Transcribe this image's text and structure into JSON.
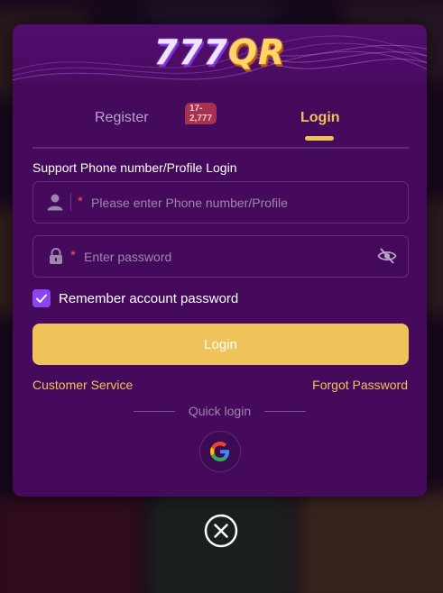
{
  "logo": {
    "numbers": "777",
    "letters": "QR"
  },
  "tabs": {
    "register_label": "Register",
    "register_badge": "17-2,777",
    "login_label": "Login"
  },
  "form": {
    "section_label": "Support Phone number/Profile Login",
    "phone_placeholder": "Please enter Phone number/Profile",
    "password_placeholder": "Enter password",
    "required_mark": "*",
    "remember_label": "Remember account password",
    "remember_checked": true,
    "login_button": "Login"
  },
  "links": {
    "customer_service": "Customer Service",
    "forgot_password": "Forgot Password"
  },
  "quick_login": {
    "label": "Quick login",
    "provider_icon": "google-icon"
  },
  "icons": {
    "user": "user-icon",
    "lock": "lock-icon",
    "eye_off": "eye-off-icon",
    "close": "close-icon"
  },
  "colors": {
    "modal_bg": "#450a5c",
    "accent": "#f0c35a",
    "checkbox": "#8a45f0",
    "required": "#ff4e5c",
    "badge": "#a8324e"
  }
}
